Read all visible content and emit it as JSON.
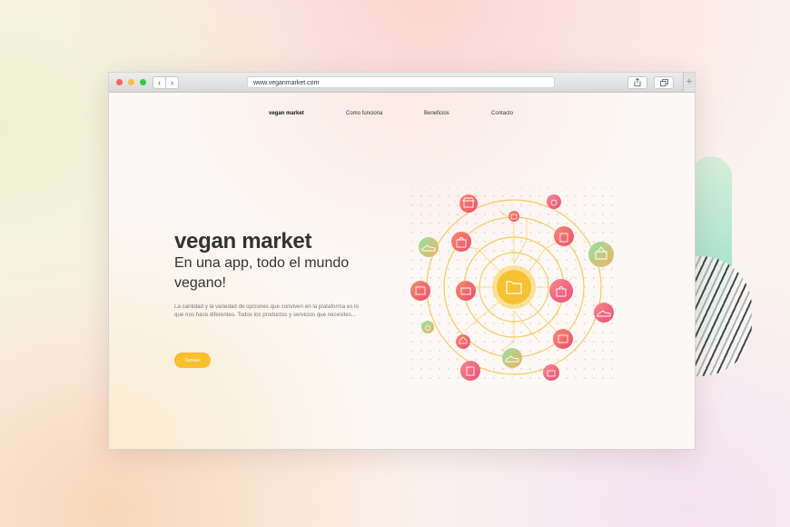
{
  "browser": {
    "url": "www.veganmarket.com",
    "back_icon": "‹",
    "forward_icon": "›",
    "new_tab_icon": "+"
  },
  "nav": {
    "brand": "vegan market",
    "items": [
      {
        "label": "Como funciona"
      },
      {
        "label": "Beneficios"
      },
      {
        "label": "Contacto"
      }
    ]
  },
  "hero": {
    "title": "vegan market",
    "subtitle": "En una app, todo el mundo vegano!",
    "description": "La cantidad y la variedad de opciones que conviven en la plataforma es lo que nos hace diferentes. Todos los productos y servicios que necesites...",
    "cta_label": "Sumate"
  },
  "illustration": {
    "center_icon": "folder-icon",
    "node_icons": [
      "store-icon",
      "shopping-bag-icon",
      "gift-icon",
      "shoe-icon",
      "apple-icon",
      "barbecue-icon",
      "milk-carton-icon",
      "basket-icon",
      "pot-icon",
      "home-icon"
    ],
    "colors": {
      "ring": "#f6c94b",
      "center": "#f7c232",
      "coral": "#f3606a",
      "pink": "#f05c7c",
      "mint": "#6fdcb7"
    }
  },
  "colors": {
    "accent": "#fcbf2e",
    "text": "#333333"
  }
}
